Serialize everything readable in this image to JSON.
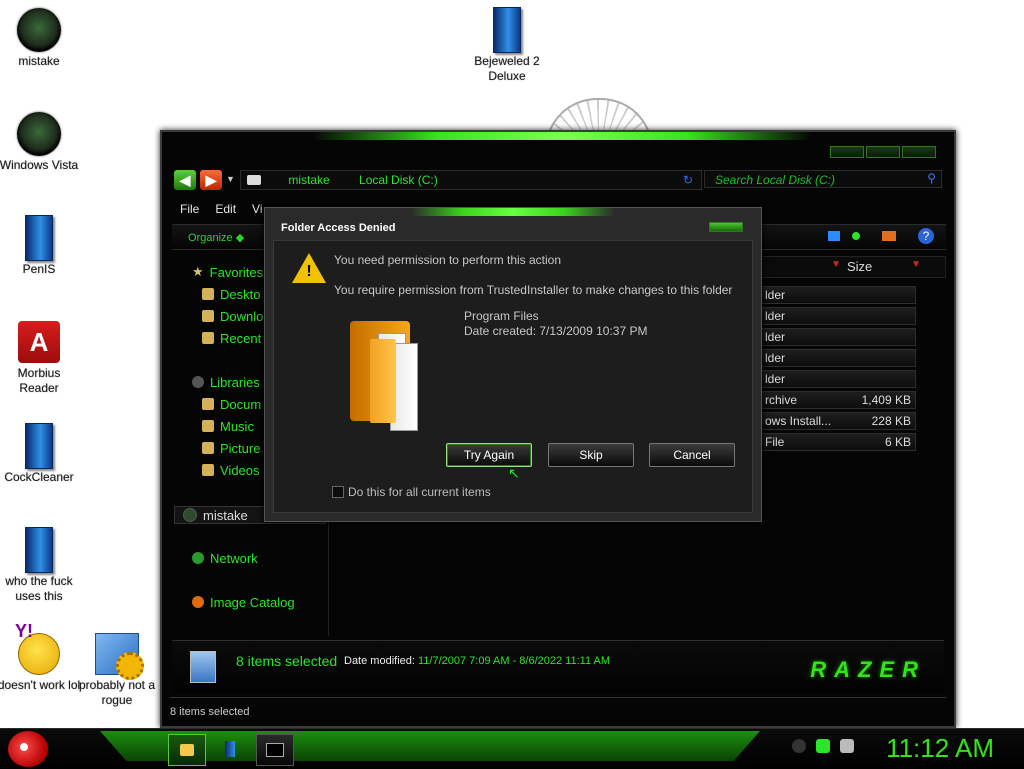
{
  "desktop": {
    "icons": [
      {
        "label": "mistake",
        "icon": "orb-icon"
      },
      {
        "label": "Bejeweled 2 Deluxe",
        "icon": "game-box-icon"
      },
      {
        "label": "Windows Vista",
        "icon": "recycle-orb-icon"
      },
      {
        "label": "PenIS",
        "icon": "game-box-icon"
      },
      {
        "label": "Morbius Reader",
        "icon": "pdf-icon"
      },
      {
        "label": "CockCleaner",
        "icon": "game-box-icon"
      },
      {
        "label": "who the fuck uses this",
        "icon": "game-box-icon"
      },
      {
        "label": "doesn't work lol",
        "icon": "yahoo-messenger-icon"
      },
      {
        "label": "probably not a rogue",
        "icon": "control-panel-icon"
      }
    ]
  },
  "explorer": {
    "address": {
      "segments": [
        "mistake",
        "Local Disk (C:)"
      ]
    },
    "search": {
      "placeholder": "Search Local Disk (C:)"
    },
    "menu": [
      "File",
      "Edit",
      "Vi"
    ],
    "command_bar": {
      "organize": "Organize"
    },
    "columns": {
      "size": "Size"
    },
    "nav": {
      "favorites": "Favorites",
      "favorite_items": [
        "Deskto",
        "Downlo",
        "Recent"
      ],
      "libraries": "Libraries",
      "library_items": [
        "Docum",
        "Music",
        "Picture",
        "Videos"
      ],
      "computer_item": "mistake",
      "network": "Network",
      "image_catalog": "Image Catalog"
    },
    "files": [
      {
        "type": "lder",
        "size": ""
      },
      {
        "type": "lder",
        "size": ""
      },
      {
        "type": "lder",
        "size": ""
      },
      {
        "type": "lder",
        "size": ""
      },
      {
        "type": "lder",
        "size": ""
      },
      {
        "type": "rchive",
        "size": "1,409 KB"
      },
      {
        "type": "ows Install...",
        "size": "228 KB"
      },
      {
        "type": "File",
        "size": "6 KB"
      }
    ],
    "details_pane": {
      "count": "8 items selected",
      "date_label": "Date modified:",
      "date_value": "11/7/2007 7:09 AM - 8/6/2022 11:11 AM",
      "brand": "RAZER"
    },
    "status": "8 items selected"
  },
  "dialog": {
    "title": "Folder Access Denied",
    "message": "You need permission to perform this action",
    "detail": "You require permission from TrustedInstaller to make changes to this folder",
    "item_name": "Program Files",
    "item_date": "Date created: 7/13/2009 10:37 PM",
    "buttons": {
      "try_again": "Try Again",
      "skip": "Skip",
      "cancel": "Cancel"
    },
    "checkbox": "Do this for all current items"
  },
  "taskbar": {
    "clock": "11:12 AM"
  }
}
